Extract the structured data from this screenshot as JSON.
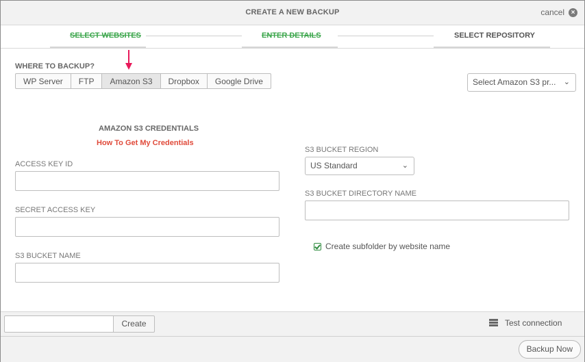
{
  "header": {
    "title": "CREATE A NEW BACKUP",
    "cancel_label": "cancel"
  },
  "steps": [
    {
      "label": "SELECT WEBSITES",
      "state": "done"
    },
    {
      "label": "ENTER DETAILS",
      "state": "done"
    },
    {
      "label": "SELECT REPOSITORY",
      "state": "active"
    }
  ],
  "where": {
    "label": "WHERE TO BACKUP?",
    "tabs": [
      "WP Server",
      "FTP",
      "Amazon S3",
      "Dropbox",
      "Google Drive"
    ],
    "active_tab": "Amazon S3"
  },
  "profile_select": {
    "value": "Select Amazon S3 pr..."
  },
  "credentials": {
    "title": "AMAZON S3 CREDENTIALS",
    "help_link": "How To Get My Credentials",
    "access_key_label": "ACCESS KEY ID",
    "secret_key_label": "SECRET ACCESS KEY",
    "bucket_name_label": "S3 BUCKET NAME",
    "access_key_value": "",
    "secret_key_value": "",
    "bucket_name_value": ""
  },
  "bucket": {
    "region_label": "S3 BUCKET REGION",
    "region_value": "US Standard",
    "directory_label": "S3 BUCKET DIRECTORY NAME",
    "directory_value": "",
    "subfolder_label": "Create subfolder by website name",
    "subfolder_checked": true
  },
  "footer": {
    "create_input_value": "",
    "create_label": "Create",
    "test_connection_label": "Test connection",
    "backup_label": "Backup Now"
  },
  "colors": {
    "done_step": "#3aa54a",
    "link": "#e04a3a",
    "arrow": "#e8195a",
    "check": "#2e8b3e"
  }
}
